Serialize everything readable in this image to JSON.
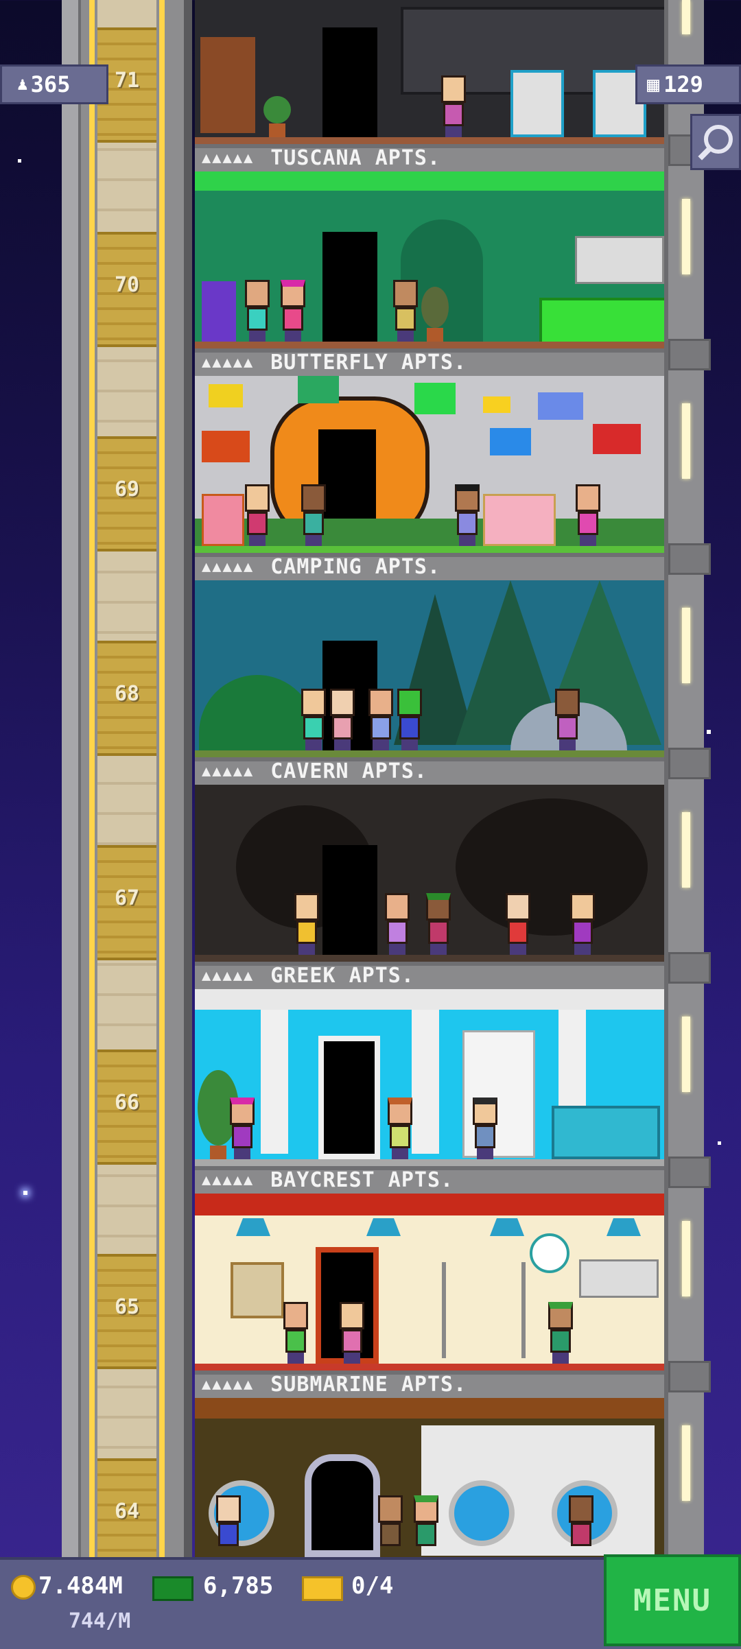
{
  "hud": {
    "population": "365",
    "current_floor": "71",
    "floors_built": "129"
  },
  "floors": [
    {
      "number": "70",
      "name": "TUSCANA APTS.",
      "dots": "▲▲▲▲▲"
    },
    {
      "number": "69",
      "name": "BUTTERFLY APTS.",
      "dots": "▲▲▲▲▲"
    },
    {
      "number": "68",
      "name": "CAMPING APTS.",
      "dots": "▲▲▲▲▲"
    },
    {
      "number": "67",
      "name": "CAVERN APTS.",
      "dots": "▲▲▲▲▲"
    },
    {
      "number": "66",
      "name": "GREEK APTS.",
      "dots": "▲▲▲▲▲"
    },
    {
      "number": "65",
      "name": "BAYCREST APTS.",
      "dots": "▲▲▲▲▲"
    },
    {
      "number": "64",
      "name": "SUBMARINE APTS.",
      "dots": "▲▲▲▲▲"
    }
  ],
  "status": {
    "coins": "7.484M",
    "bux": "6,785",
    "tickets": "0/4",
    "income": "744/M"
  },
  "menu_label": "MENU",
  "colors": {
    "tuscana": "#2a2a2e",
    "butterfly": "#1d8a5a",
    "camping": "#c8c8cc",
    "cavern": "#1f6e86",
    "greek": "#2c2826",
    "baycrest": "#1ec6ee",
    "submarine": "#f7edcf",
    "bottom_room": "#4a3c1a",
    "menu": "#21b446"
  }
}
